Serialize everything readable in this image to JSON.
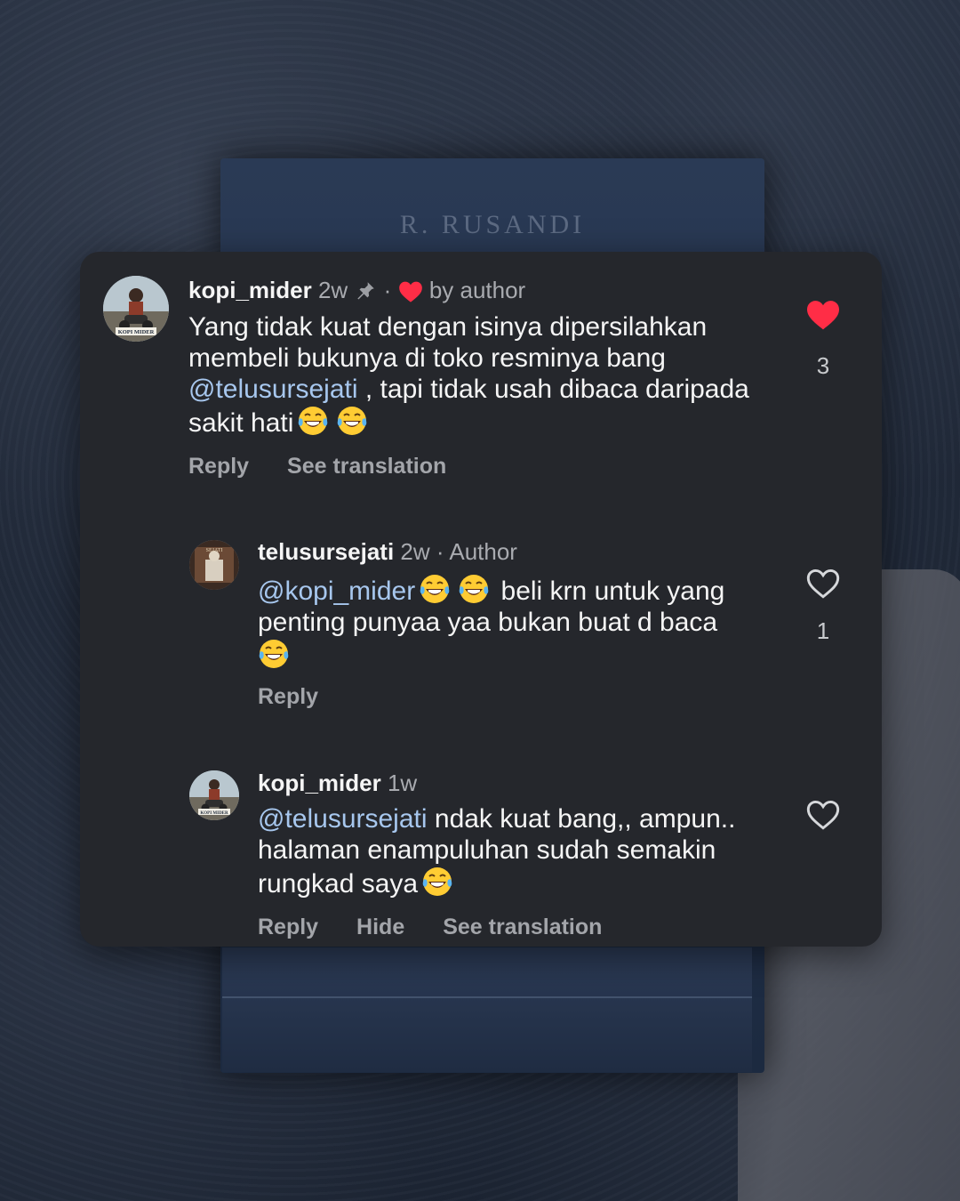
{
  "background": {
    "book_author": "R. RUSANDI"
  },
  "comments": [
    {
      "username": "kopi_mider",
      "time": "2w",
      "separator": "·",
      "badge": "by author",
      "badge_icon": "heart-icon",
      "pin_icon": "pin-icon",
      "avatar_label": "KOPI MIDER",
      "text_part1": "Yang tidak kuat dengan isinya dipersilahkan membeli bukunya di toko resminya bang ",
      "mention": "@telusursejati",
      "text_part2": " , tapi tidak usah dibaca daripada sakit hati",
      "emojis": [
        "😂",
        "😂"
      ],
      "liked": true,
      "like_count": "3",
      "actions": [
        "Reply",
        "See translation"
      ]
    },
    {
      "username": "telusursejati",
      "time": "2w",
      "separator": "·",
      "badge": "Author",
      "avatar_label": "SEJATI",
      "mention": "@kopi_mider",
      "text_part1": " beli krn untuk yang penting punyaa yaa bukan buat d baca",
      "emojis": [
        "😂",
        "😂",
        "😂"
      ],
      "liked": false,
      "like_count": "1",
      "actions": [
        "Reply"
      ]
    },
    {
      "username": "kopi_mider",
      "time": "1w",
      "avatar_label": "KOPI MIDER",
      "mention": "@telusursejati",
      "text_part1": " ndak kuat bang,, ampun.. halaman enampuluhan sudah semakin rungkad saya",
      "emojis": [
        "😂"
      ],
      "liked": false,
      "like_count": "",
      "actions": [
        "Reply",
        "Hide",
        "See translation"
      ]
    }
  ],
  "colors": {
    "card_bg": "#25272c",
    "mention": "#a7c7ee",
    "like_red": "#ff2d46"
  }
}
